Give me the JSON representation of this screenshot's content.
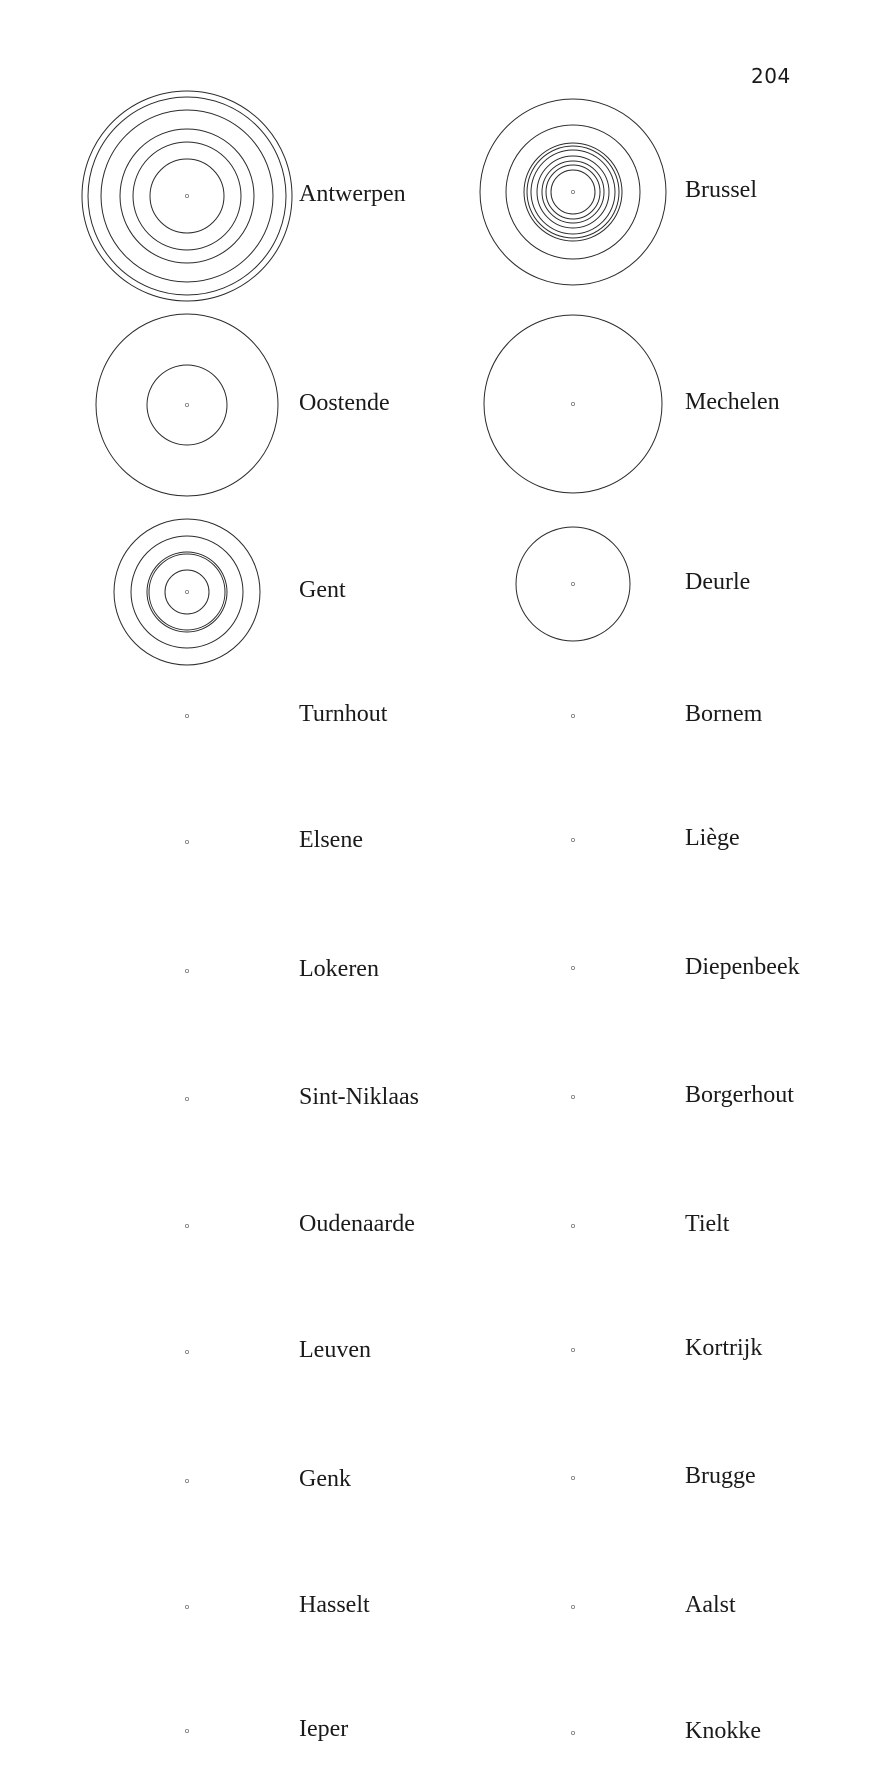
{
  "page": {
    "number": "204"
  },
  "places": [
    {
      "name": "Antwerpen",
      "rings": 6
    },
    {
      "name": "Brussel",
      "rings": 9
    },
    {
      "name": "Oostende",
      "rings": 2
    },
    {
      "name": "Mechelen",
      "rings": 1
    },
    {
      "name": "Gent",
      "rings": 5
    },
    {
      "name": "Deurle",
      "rings": 1
    },
    {
      "name": "Turnhout",
      "rings": 0
    },
    {
      "name": "Bornem",
      "rings": 0
    },
    {
      "name": "Elsene",
      "rings": 0
    },
    {
      "name": "Liège",
      "rings": 0
    },
    {
      "name": "Lokeren",
      "rings": 0
    },
    {
      "name": "Diepenbeek",
      "rings": 0
    },
    {
      "name": "Sint-Niklaas",
      "rings": 0
    },
    {
      "name": "Borgerhout",
      "rings": 0
    },
    {
      "name": "Oudenaarde",
      "rings": 0
    },
    {
      "name": "Tielt",
      "rings": 0
    },
    {
      "name": "Leuven",
      "rings": 0
    },
    {
      "name": "Kortrijk",
      "rings": 0
    },
    {
      "name": "Genk",
      "rings": 0
    },
    {
      "name": "Brugge",
      "rings": 0
    },
    {
      "name": "Hasselt",
      "rings": 0
    },
    {
      "name": "Aalst",
      "rings": 0
    },
    {
      "name": "Ieper",
      "rings": 0
    },
    {
      "name": "Knokke",
      "rings": 0
    }
  ]
}
